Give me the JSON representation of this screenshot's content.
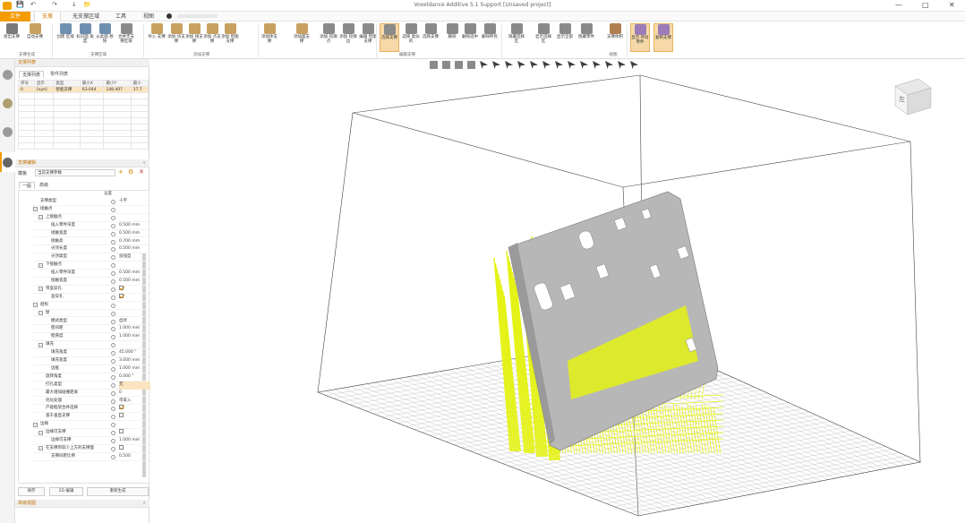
{
  "window": {
    "title": "Voxeldance Additive   5.1   Support   [Unsaved project]"
  },
  "quick_access": {
    "undo_icon": "undo-icon",
    "redo_icon": "redo-icon",
    "save_icon": "save-icon",
    "open_icon": "open-icon"
  },
  "ribbon_tabs": [
    {
      "label": "文件"
    },
    {
      "label": "支撑"
    },
    {
      "label": "无支撑区域"
    },
    {
      "label": "工具"
    },
    {
      "label": "视图"
    }
  ],
  "ribbon": {
    "buttons": [
      {
        "label": "退出支撑"
      },
      {
        "label": "自动支撑"
      },
      {
        "label": "创建 区域"
      },
      {
        "label": "标识面 角度"
      },
      {
        "label": "从此面 移除"
      },
      {
        "label": "合并无支撑区域"
      },
      {
        "label": "导入 支撑"
      },
      {
        "label": "添加 块支撑"
      },
      {
        "label": "添加 线支撑"
      },
      {
        "label": "添加 点支撑"
      },
      {
        "label": "添加 智能支撑"
      },
      {
        "label": "添加体支撑"
      },
      {
        "label": "添加面支撑"
      },
      {
        "label": "添加 轮廓点"
      },
      {
        "label": "添加 轮廓边"
      },
      {
        "label": "编辑 智能支撑"
      },
      {
        "label": "选择支撑"
      },
      {
        "label": "选择 类似的"
      },
      {
        "label": "选择支撑"
      },
      {
        "label": "删除"
      },
      {
        "label": "删除选中"
      },
      {
        "label": "删除所有"
      },
      {
        "label": "隐藏选择区"
      },
      {
        "label": "显示选择区"
      },
      {
        "label": "显示全部"
      },
      {
        "label": "隐藏零件"
      },
      {
        "label": "支撑体积"
      },
      {
        "label": "显示 所有零件"
      },
      {
        "label": "复制支撑"
      }
    ],
    "groups": [
      {
        "label": "支撑生成"
      },
      {
        "label": "支撑区域"
      },
      {
        "label": "添加支撑"
      },
      {
        "label": "编辑支撑"
      },
      {
        "label": "视图"
      }
    ]
  },
  "panel": {
    "list_header": "支撑列表",
    "list_tabs": [
      {
        "label": "支撑列表"
      },
      {
        "label": "零件列表"
      }
    ],
    "table_columns": [
      "序号",
      "显示",
      "类型",
      "最小X",
      "最小Y",
      "最小"
    ],
    "table_rows": [
      [
        "0",
        "[eye]",
        "智能支撑",
        "63.044",
        "148.407",
        "17.7"
      ]
    ],
    "params_header": "支撑编辑",
    "template_label": "模板",
    "template_value": "当前支撑参数",
    "param_tabs": [
      {
        "label": "一般"
      },
      {
        "label": "高级"
      }
    ],
    "params_column": "设置",
    "params": [
      {
        "name": "支撑类型",
        "value": "十字",
        "indent": 0,
        "toggle": ""
      },
      {
        "name": "接触点",
        "value": "",
        "indent": 0,
        "toggle": "−"
      },
      {
        "name": "上接触点",
        "value": "",
        "indent": 1,
        "toggle": "−"
      },
      {
        "name": "插入零件深度",
        "value": "0.500 mm",
        "indent": 2,
        "toggle": ""
      },
      {
        "name": "接触宽度",
        "value": "0.500 mm",
        "indent": 2,
        "toggle": ""
      },
      {
        "name": "接触高",
        "value": "0.700 mm",
        "indent": 2,
        "toggle": ""
      },
      {
        "name": "尖顶长度",
        "value": "0.500 mm",
        "indent": 2,
        "toggle": ""
      },
      {
        "name": "尖顶类型",
        "value": "加强型",
        "indent": 2,
        "toggle": ""
      },
      {
        "name": "下接触点",
        "value": "",
        "indent": 1,
        "toggle": "−"
      },
      {
        "name": "插入零件深度",
        "value": "0.500 mm",
        "indent": 2,
        "toggle": ""
      },
      {
        "name": "接触宽度",
        "value": "0.500 mm",
        "indent": 2,
        "toggle": ""
      },
      {
        "name": "带盒穿孔",
        "value": "[x]",
        "indent": 1,
        "toggle": "−"
      },
      {
        "name": "盒穿孔",
        "value": "[x]",
        "indent": 2,
        "toggle": ""
      },
      {
        "name": "结构",
        "value": "",
        "indent": 0,
        "toggle": "−"
      },
      {
        "name": "壁",
        "value": "",
        "indent": 1,
        "toggle": "−"
      },
      {
        "name": "模式类型",
        "value": "齿状",
        "indent": 2,
        "toggle": ""
      },
      {
        "name": "壁间距",
        "value": "1.000 mm",
        "indent": 2,
        "toggle": ""
      },
      {
        "name": "壁厚度",
        "value": "1.000 mm",
        "indent": 2,
        "toggle": ""
      },
      {
        "name": "填充",
        "value": "",
        "indent": 1,
        "toggle": "−"
      },
      {
        "name": "填充角度",
        "value": "45.000 °",
        "indent": 2,
        "toggle": ""
      },
      {
        "name": "填充宽度",
        "value": "3.000 mm",
        "indent": 2,
        "toggle": ""
      },
      {
        "name": "边框",
        "value": "1.000 mm",
        "indent": 2,
        "toggle": ""
      },
      {
        "name": "旋转角度",
        "value": "0.000 °",
        "indent": 1,
        "toggle": ""
      },
      {
        "name": "打孔类型",
        "value": "无",
        "indent": 1,
        "toggle": "",
        "highlight": true
      },
      {
        "name": "最大增加碰撞距离",
        "value": "0",
        "indent": 1,
        "toggle": ""
      },
      {
        "name": "优化处理",
        "value": "带束入",
        "indent": 1,
        "toggle": ""
      },
      {
        "name": "产能框架合并选择",
        "value": "[x]",
        "indent": 1,
        "toggle": ""
      },
      {
        "name": "基于垂直支撑",
        "value": "[ ]",
        "indent": 1,
        "toggle": ""
      },
      {
        "name": "边缘",
        "value": "",
        "indent": 0,
        "toggle": "−"
      },
      {
        "name": "边缘可支撑",
        "value": "[ ]",
        "indent": 1,
        "toggle": "−"
      },
      {
        "name": "边缘可支撑",
        "value": "1.000 mm",
        "indent": 2,
        "toggle": ""
      },
      {
        "name": "在支撑到较少上方的支撑面",
        "value": "[ ]",
        "indent": 1,
        "toggle": "−"
      },
      {
        "name": "支撑间距比例",
        "value": "0.500",
        "indent": 2,
        "toggle": ""
      }
    ],
    "buttons": [
      {
        "label": "保存"
      },
      {
        "label": "2D 编辑"
      },
      {
        "label": "重新生成"
      }
    ],
    "bottom_header": "高级视图"
  },
  "viewport": {
    "view_cube_label": "左",
    "accent_color": "#e4f214",
    "part_color": "#b7b7b7"
  }
}
